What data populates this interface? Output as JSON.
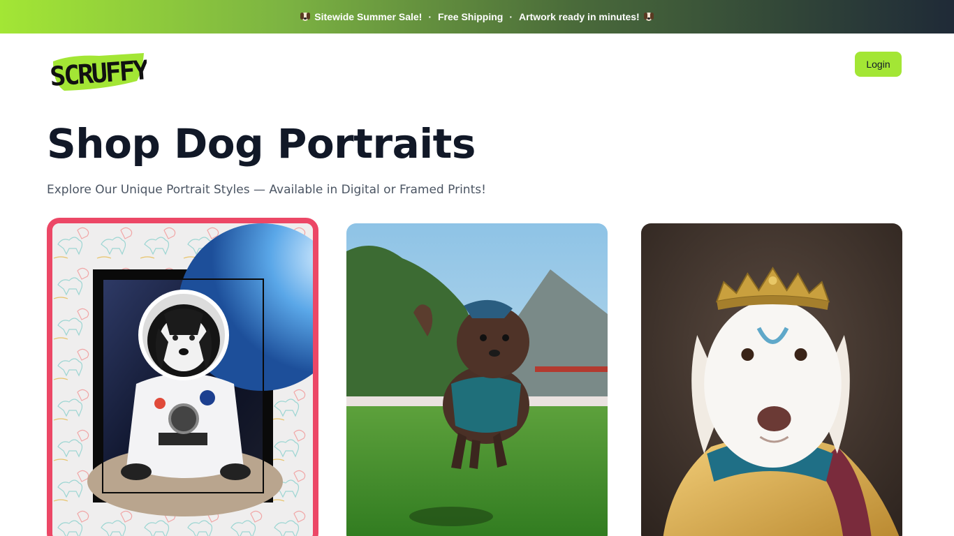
{
  "banner": {
    "item1": "Sitewide Summer Sale!",
    "item2": "Free Shipping",
    "item3": "Artwork ready in minutes!",
    "separator": "·",
    "icon": "dog-face-icon"
  },
  "header": {
    "logo_text": "SCRUFFY",
    "login_label": "Login"
  },
  "main": {
    "title": "Shop Dog Portraits",
    "subtitle": "Explore Our Unique Portrait Styles — Available in Digital or Framed Prints!"
  },
  "products": [
    {
      "style": "astronaut-dog-portrait",
      "selected": true
    },
    {
      "style": "running-dog-portrait",
      "selected": false
    },
    {
      "style": "royal-dog-portrait",
      "selected": false
    }
  ],
  "colors": {
    "accent": "#a3e635",
    "selection_border": "#ec4766",
    "heading": "#111827",
    "subtitle": "#4b5563"
  }
}
